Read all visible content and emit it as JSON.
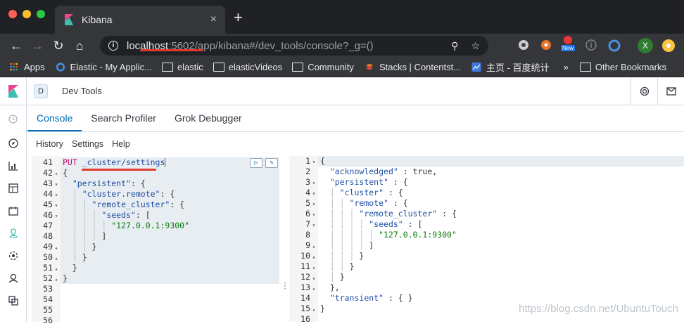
{
  "browser": {
    "tab_title": "Kibana",
    "tab_close": "×",
    "new_tab": "+",
    "url_host": "localhost",
    "url_rest": ":5602/app/kibana#/dev_tools/console?_g=()",
    "ext_new_badge": "New",
    "profile_initial": "X"
  },
  "bookmarks": [
    {
      "label": "Apps",
      "icon": "apps-grid-icon"
    },
    {
      "label": "Elastic - My Applic...",
      "icon": "elastic-logo-icon"
    },
    {
      "label": "elastic",
      "icon": "folder-icon"
    },
    {
      "label": "elasticVideos",
      "icon": "folder-icon"
    },
    {
      "label": "Community",
      "icon": "folder-icon"
    },
    {
      "label": "Stacks | Contentst...",
      "icon": "stacks-logo-icon"
    },
    {
      "label": "主页 - 百度统计",
      "icon": "chart-icon"
    }
  ],
  "bookmarks_more": "»",
  "bookmarks_other": "Other Bookmarks",
  "kibana": {
    "space_initial": "D",
    "breadcrumb": "Dev Tools",
    "tabs": [
      "Console",
      "Search Profiler",
      "Grok Debugger"
    ],
    "submenu": [
      "History",
      "Settings",
      "Help"
    ]
  },
  "request_lines": [
    {
      "n": "41",
      "fold": "",
      "code": [
        [
          "kw",
          "PUT "
        ],
        [
          "key",
          "_cluster/settings"
        ]
      ]
    },
    {
      "n": "42",
      "fold": "▾",
      "code": [
        [
          "pun",
          "{"
        ]
      ]
    },
    {
      "n": "43",
      "fold": "▾",
      "code": [
        [
          "pun",
          "  "
        ],
        [
          "key",
          "\"persistent\""
        ],
        [
          "pun",
          ": {"
        ]
      ]
    },
    {
      "n": "44",
      "fold": "▾",
      "code": [
        [
          "ig",
          "  │ "
        ],
        [
          "key",
          "\"cluster.remote\""
        ],
        [
          "pun",
          ": {"
        ]
      ]
    },
    {
      "n": "45",
      "fold": "▾",
      "code": [
        [
          "ig",
          "  │ │ "
        ],
        [
          "key",
          "\"remote_cluster\""
        ],
        [
          "pun",
          ": {"
        ]
      ]
    },
    {
      "n": "46",
      "fold": "▾",
      "code": [
        [
          "ig",
          "  │ │ │ "
        ],
        [
          "key",
          "\"seeds\""
        ],
        [
          "pun",
          ": ["
        ]
      ]
    },
    {
      "n": "47",
      "fold": "",
      "code": [
        [
          "ig",
          "  │ │ │ │ "
        ],
        [
          "str",
          "\"127.0.0.1:9300\""
        ]
      ]
    },
    {
      "n": "48",
      "fold": "",
      "code": [
        [
          "ig",
          "  │ │ │ "
        ],
        [
          "pun",
          "]"
        ]
      ]
    },
    {
      "n": "49",
      "fold": "▴",
      "code": [
        [
          "ig",
          "  │ │ "
        ],
        [
          "pun",
          "}"
        ]
      ]
    },
    {
      "n": "50",
      "fold": "▴",
      "code": [
        [
          "ig",
          "  │ "
        ],
        [
          "pun",
          "}"
        ]
      ]
    },
    {
      "n": "51",
      "fold": "▴",
      "code": [
        [
          "pun",
          "  }"
        ]
      ]
    },
    {
      "n": "52",
      "fold": "▴",
      "code": [
        [
          "pun",
          "}"
        ]
      ]
    },
    {
      "n": "53",
      "fold": "",
      "code": []
    },
    {
      "n": "54",
      "fold": "",
      "code": []
    },
    {
      "n": "55",
      "fold": "",
      "code": []
    },
    {
      "n": "56",
      "fold": "",
      "code": []
    }
  ],
  "response_lines": [
    {
      "n": "1",
      "fold": "▾",
      "code": [
        [
          "pun",
          "{"
        ]
      ]
    },
    {
      "n": "2",
      "fold": "",
      "code": [
        [
          "pun",
          "  "
        ],
        [
          "key",
          "\"acknowledged\""
        ],
        [
          "pun",
          " : "
        ],
        [
          "num",
          "true"
        ],
        [
          "pun",
          ","
        ]
      ]
    },
    {
      "n": "3",
      "fold": "▾",
      "code": [
        [
          "pun",
          "  "
        ],
        [
          "key",
          "\"persistent\""
        ],
        [
          "pun",
          " : {"
        ]
      ]
    },
    {
      "n": "4",
      "fold": "▾",
      "code": [
        [
          "ig",
          "  │ "
        ],
        [
          "key",
          "\"cluster\""
        ],
        [
          "pun",
          " : {"
        ]
      ]
    },
    {
      "n": "5",
      "fold": "▾",
      "code": [
        [
          "ig",
          "  │ │ "
        ],
        [
          "key",
          "\"remote\""
        ],
        [
          "pun",
          " : {"
        ]
      ]
    },
    {
      "n": "6",
      "fold": "▾",
      "code": [
        [
          "ig",
          "  │ │ │ "
        ],
        [
          "key",
          "\"remote_cluster\""
        ],
        [
          "pun",
          " : {"
        ]
      ]
    },
    {
      "n": "7",
      "fold": "▾",
      "code": [
        [
          "ig",
          "  │ │ │ │ "
        ],
        [
          "key",
          "\"seeds\""
        ],
        [
          "pun",
          " : ["
        ]
      ]
    },
    {
      "n": "8",
      "fold": "",
      "code": [
        [
          "ig",
          "  │ │ │ │ │ "
        ],
        [
          "str",
          "\"127.0.0.1:9300\""
        ]
      ]
    },
    {
      "n": "9",
      "fold": "▴",
      "code": [
        [
          "ig",
          "  │ │ │ │ "
        ],
        [
          "pun",
          "]"
        ]
      ]
    },
    {
      "n": "10",
      "fold": "▴",
      "code": [
        [
          "ig",
          "  │ │ │ "
        ],
        [
          "pun",
          "}"
        ]
      ]
    },
    {
      "n": "11",
      "fold": "▴",
      "code": [
        [
          "ig",
          "  │ │ "
        ],
        [
          "pun",
          "}"
        ]
      ]
    },
    {
      "n": "12",
      "fold": "▴",
      "code": [
        [
          "ig",
          "  │ "
        ],
        [
          "pun",
          "}"
        ]
      ]
    },
    {
      "n": "13",
      "fold": "▴",
      "code": [
        [
          "pun",
          "  },"
        ]
      ]
    },
    {
      "n": "14",
      "fold": "",
      "code": [
        [
          "pun",
          "  "
        ],
        [
          "key",
          "\"transient\""
        ],
        [
          "pun",
          " : { }"
        ]
      ]
    },
    {
      "n": "15",
      "fold": "▴",
      "code": [
        [
          "pun",
          "}"
        ]
      ]
    },
    {
      "n": "16",
      "fold": "",
      "code": []
    }
  ],
  "watermark": "https://blog.csdn.net/UbuntuTouch",
  "colors": {
    "accent": "#006bb4",
    "annotation": "#e03a2e",
    "kibana_pink": "#e8488b",
    "kibana_teal": "#3ebeb0"
  }
}
